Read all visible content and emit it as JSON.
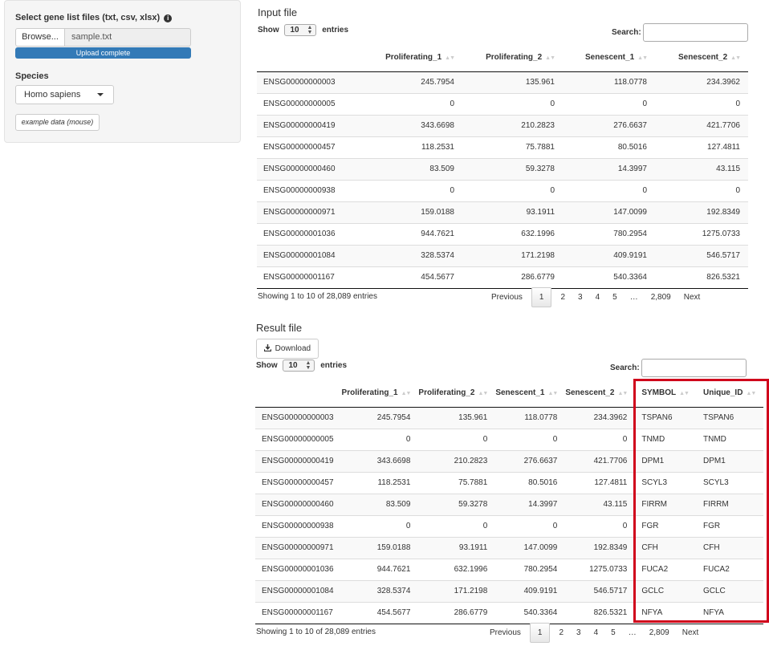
{
  "sidebar": {
    "file_label": "Select gene list files (txt, csv, xlsx)",
    "info_icon": "i",
    "browse_label": "Browse...",
    "file_name": "sample.txt",
    "upload_status": "Upload complete",
    "upload_progress_pct": 100,
    "species_label": "Species",
    "species_value": "Homo sapiens",
    "example_button": "example data (mouse)"
  },
  "input_file": {
    "title": "Input file",
    "show_label": "Show",
    "length_value": "10",
    "entries_label": "entries",
    "search_label": "Search:",
    "columns": [
      "",
      "Proliferating_1",
      "Proliferating_2",
      "Senescent_1",
      "Senescent_2"
    ],
    "rows": [
      [
        "ENSG00000000003",
        "245.7954",
        "135.961",
        "118.0778",
        "234.3962"
      ],
      [
        "ENSG00000000005",
        "0",
        "0",
        "0",
        "0"
      ],
      [
        "ENSG00000000419",
        "343.6698",
        "210.2823",
        "276.6637",
        "421.7706"
      ],
      [
        "ENSG00000000457",
        "118.2531",
        "75.7881",
        "80.5016",
        "127.4811"
      ],
      [
        "ENSG00000000460",
        "83.509",
        "59.3278",
        "14.3997",
        "43.115"
      ],
      [
        "ENSG00000000938",
        "0",
        "0",
        "0",
        "0"
      ],
      [
        "ENSG00000000971",
        "159.0188",
        "93.1911",
        "147.0099",
        "192.8349"
      ],
      [
        "ENSG00000001036",
        "944.7621",
        "632.1996",
        "780.2954",
        "1275.0733"
      ],
      [
        "ENSG00000001084",
        "328.5374",
        "171.2198",
        "409.9191",
        "546.5717"
      ],
      [
        "ENSG00000001167",
        "454.5677",
        "286.6779",
        "540.3364",
        "826.5321"
      ]
    ],
    "info": "Showing 1 to 10 of 28,089 entries",
    "pager": {
      "previous": "Previous",
      "pages": [
        "1",
        "2",
        "3",
        "4",
        "5",
        "…",
        "2,809"
      ],
      "next": "Next"
    }
  },
  "result_file": {
    "title": "Result file",
    "download_label": "Download",
    "show_label": "Show",
    "length_value": "10",
    "entries_label": "entries",
    "search_label": "Search:",
    "columns": [
      "",
      "Proliferating_1",
      "Proliferating_2",
      "Senescent_1",
      "Senescent_2",
      "SYMBOL",
      "Unique_ID"
    ],
    "rows": [
      [
        "ENSG00000000003",
        "245.7954",
        "135.961",
        "118.0778",
        "234.3962",
        "TSPAN6",
        "TSPAN6"
      ],
      [
        "ENSG00000000005",
        "0",
        "0",
        "0",
        "0",
        "TNMD",
        "TNMD"
      ],
      [
        "ENSG00000000419",
        "343.6698",
        "210.2823",
        "276.6637",
        "421.7706",
        "DPM1",
        "DPM1"
      ],
      [
        "ENSG00000000457",
        "118.2531",
        "75.7881",
        "80.5016",
        "127.4811",
        "SCYL3",
        "SCYL3"
      ],
      [
        "ENSG00000000460",
        "83.509",
        "59.3278",
        "14.3997",
        "43.115",
        "FIRRM",
        "FIRRM"
      ],
      [
        "ENSG00000000938",
        "0",
        "0",
        "0",
        "0",
        "FGR",
        "FGR"
      ],
      [
        "ENSG00000000971",
        "159.0188",
        "93.1911",
        "147.0099",
        "192.8349",
        "CFH",
        "CFH"
      ],
      [
        "ENSG00000001036",
        "944.7621",
        "632.1996",
        "780.2954",
        "1275.0733",
        "FUCA2",
        "FUCA2"
      ],
      [
        "ENSG00000001084",
        "328.5374",
        "171.2198",
        "409.9191",
        "546.5717",
        "GCLC",
        "GCLC"
      ],
      [
        "ENSG00000001167",
        "454.5677",
        "286.6779",
        "540.3364",
        "826.5321",
        "NFYA",
        "NFYA"
      ]
    ],
    "info": "Showing 1 to 10 of 28,089 entries",
    "pager": {
      "previous": "Previous",
      "pages": [
        "1",
        "2",
        "3",
        "4",
        "5",
        "…",
        "2,809"
      ],
      "next": "Next"
    }
  },
  "colors": {
    "accent": "#337ab7",
    "highlight": "#d0021b"
  }
}
